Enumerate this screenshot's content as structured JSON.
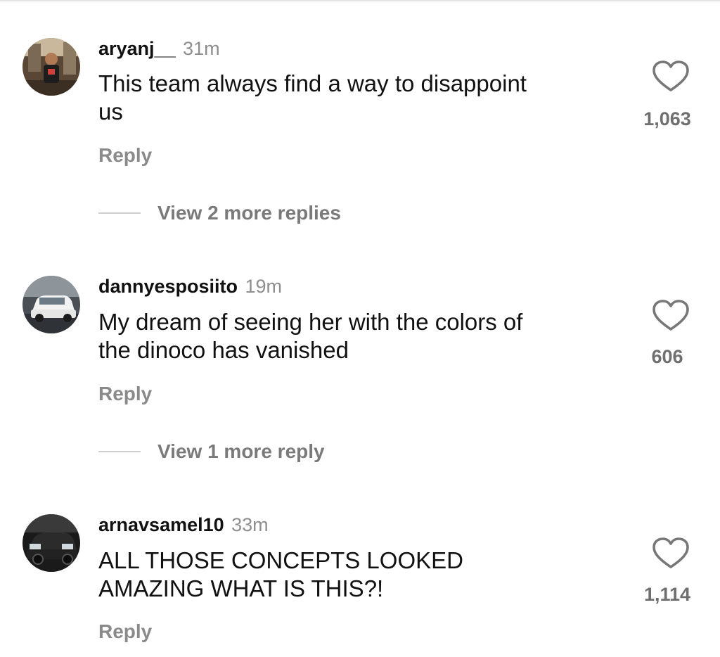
{
  "comments": [
    {
      "username": "aryanj__",
      "time": "31m",
      "text_lines": [
        "This team always find a way to disappoint",
        "us"
      ],
      "likes": "1,063",
      "reply_label": "Reply",
      "view_more": "View 2 more replies"
    },
    {
      "username": "dannyesposiito",
      "time": "19m",
      "text_lines": [
        "My dream of seeing her with the colors of",
        "the dinoco has vanished"
      ],
      "likes": "606",
      "reply_label": "Reply",
      "view_more": "View 1 more reply"
    },
    {
      "username": "arnavsamel10",
      "time": "33m",
      "text_lines": [
        "ALL THOSE CONCEPTS LOOKED",
        "AMAZING WHAT IS THIS?!"
      ],
      "likes": "1,114",
      "reply_label": "Reply"
    }
  ],
  "icons": {
    "like": "heart-outline-icon"
  },
  "colors": {
    "username": "#111111",
    "muted": "#8e8e8e",
    "divider": "#cfcfcf"
  }
}
